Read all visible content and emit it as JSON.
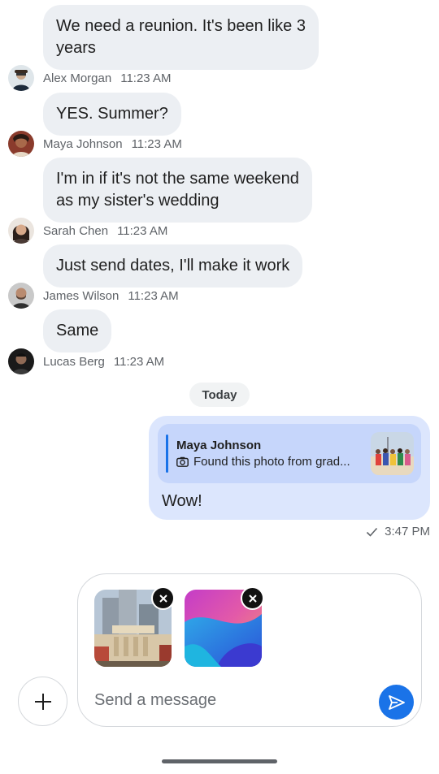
{
  "messages": [
    {
      "text_lines": [
        "We need a reunion. It's been like 3",
        "years"
      ],
      "sender": "Alex Morgan",
      "time": "11:23 AM"
    },
    {
      "text_lines": [
        "YES. Summer?"
      ],
      "sender": "Maya Johnson",
      "time": "11:23 AM"
    },
    {
      "text_lines": [
        "I'm in if it's not the same weekend",
        "as my sister's wedding"
      ],
      "sender": "Sarah Chen",
      "time": "11:23 AM"
    },
    {
      "text_lines": [
        "Just send dates, I'll make it work"
      ],
      "sender": "James Wilson",
      "time": "11:23 AM"
    },
    {
      "text_lines": [
        "Same"
      ],
      "sender": "Lucas Berg",
      "time": "11:23 AM"
    }
  ],
  "day_divider": "Today",
  "outgoing": {
    "reply_author": "Maya Johnson",
    "reply_snippet": "Found this photo from grad...",
    "reply_icon": "camera-icon",
    "text": "Wow!",
    "status_icon": "check-icon",
    "time": "3:47 PM"
  },
  "composer": {
    "placeholder": "Send a message",
    "attachments": [
      "city-building-photo",
      "abstract-wallpaper"
    ],
    "add_icon": "plus-icon",
    "send_icon": "send-icon",
    "remove_icon": "close-icon"
  },
  "colors": {
    "accent": "#1a73e8",
    "incoming_bubble": "#eceff3",
    "outgoing_bubble": "#dce6fd",
    "reply_card": "#c6d6fb"
  }
}
